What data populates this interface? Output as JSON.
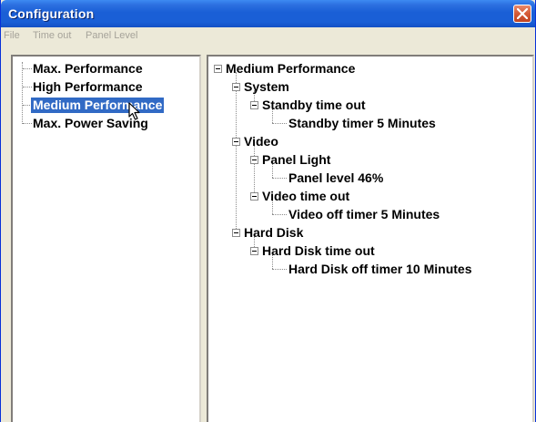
{
  "window": {
    "title": "Configuration"
  },
  "menu": [
    "File",
    "Time out",
    "Panel Level"
  ],
  "profiles": {
    "items": [
      "Max. Performance",
      "High Performance",
      "Medium Performance",
      "Max. Power Saving"
    ],
    "selected": "Medium Performance"
  },
  "details": {
    "root": "Medium Performance",
    "system": "System",
    "standby_timeout": "Standby time out",
    "standby_timer": "Standby timer 5 Minutes",
    "video": "Video",
    "panel_light": "Panel Light",
    "panel_level": "Panel level 46%",
    "video_timeout": "Video time out",
    "video_off_timer": "Video off timer 5 Minutes",
    "hard_disk": "Hard Disk",
    "hard_disk_timeout": "Hard Disk time out",
    "hard_disk_off_timer": "Hard Disk off timer 10 Minutes"
  },
  "colors": {
    "title_bar": "#1a5fd6",
    "selection": "#316ac5",
    "close_button": "#d55a36"
  },
  "icons": {
    "close": "close-icon",
    "expander": "minus-box-icon",
    "pointer": "arrow-cursor-icon"
  }
}
